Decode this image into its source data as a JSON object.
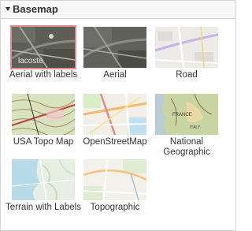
{
  "section": {
    "title": "Basemap"
  },
  "basemaps": [
    {
      "label": "Aerial with labels",
      "selected": true
    },
    {
      "label": "Aerial",
      "selected": false
    },
    {
      "label": "Road",
      "selected": false
    },
    {
      "label": "USA Topo Map",
      "selected": false
    },
    {
      "label": "OpenStreetMap",
      "selected": false
    },
    {
      "label": "National Geographic",
      "selected": false
    },
    {
      "label": "Terrain with Labels",
      "selected": false
    },
    {
      "label": "Topographic",
      "selected": false
    }
  ],
  "colors": {
    "selected_border": "#e48a8a",
    "header_bg": "#f7f7f7"
  }
}
